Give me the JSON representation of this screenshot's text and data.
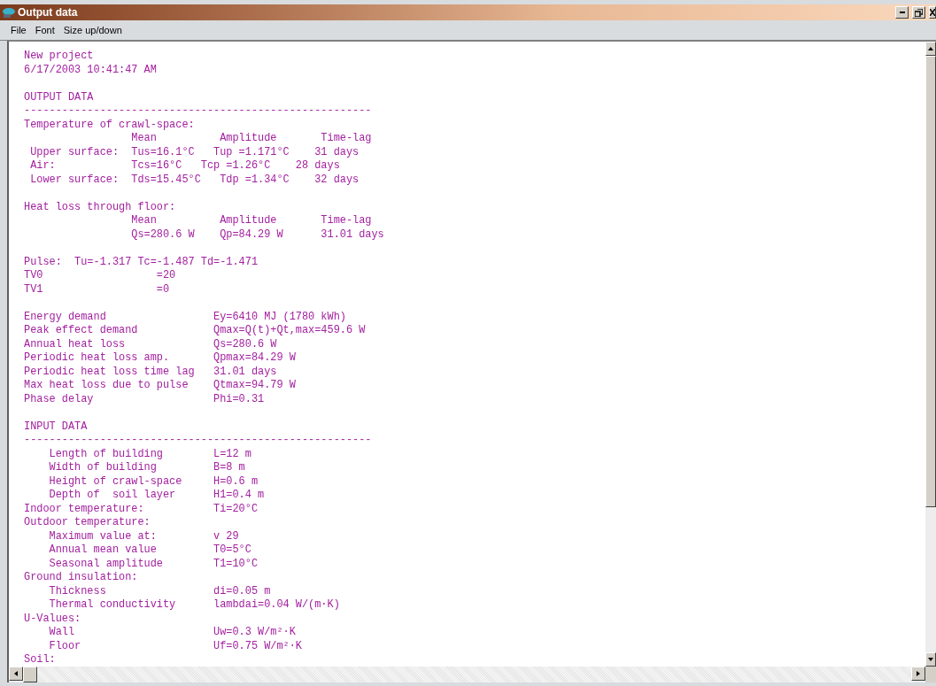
{
  "window": {
    "title": "Output data"
  },
  "menu": [
    {
      "label": "File"
    },
    {
      "label": "Font"
    },
    {
      "label": "Size up/down"
    }
  ],
  "blocks": [
    {
      "lines": [
        "New project",
        "6/17/2003 10:41:47 AM"
      ]
    },
    {
      "lines": [
        "OUTPUT DATA",
        "-------------------------------------------------------",
        "Temperature of crawl-space:",
        "                 Mean          Amplitude       Time-lag",
        " Upper surface:  Tus=16.1°C   Tup =1.171°C    31 days",
        " Air:            Tcs=16°C   Tcp =1.26°C    28 days",
        " Lower surface:  Tds=15.45°C   Tdp =1.34°C    32 days"
      ]
    },
    {
      "lines": [
        "Heat loss through floor:",
        "                 Mean          Amplitude       Time-lag",
        "                 Qs=280.6 W    Qp=84.29 W      31.01 days"
      ]
    },
    {
      "lines": [
        "Pulse:  Tu=-1.317 Tc=-1.487 Td=-1.471",
        "TV0                  =20",
        "TV1                  =0"
      ]
    },
    {
      "lines": [
        "Energy demand                 Ey=6410 MJ (1780 kWh)",
        "Peak effect demand            Qmax=Q(t)+Qt,max=459.6 W",
        "Annual heat loss              Qs=280.6 W",
        "Periodic heat loss amp.       Qpmax=84.29 W",
        "Periodic heat loss time lag   31.01 days",
        "Max heat loss due to pulse    Qtmax=94.79 W",
        "Phase delay                   Phi=0.31"
      ]
    },
    {
      "lines": [
        "INPUT DATA",
        "-------------------------------------------------------",
        "    Length of building        L=12 m",
        "    Width of building         B=8 m",
        "    Height of crawl-space     H=0.6 m",
        "    Depth of  soil layer      H1=0.4 m",
        "Indoor temperature:           Ti=20°C",
        "Outdoor temperature:",
        "    Maximum value at:         v 29",
        "    Annual mean value         T0=5°C",
        "    Seasonal amplitude        T1=10°C",
        "Ground insulation:",
        "    Thickness                 di=0.05 m",
        "    Thermal conductivity      lambdai=0.04 W/(m·K)",
        "U-Values:",
        "    Wall                      Uw=0.3 W/m²·K",
        "    Floor                     Uf=0.75 W/m²·K",
        "Soil:"
      ]
    }
  ]
}
